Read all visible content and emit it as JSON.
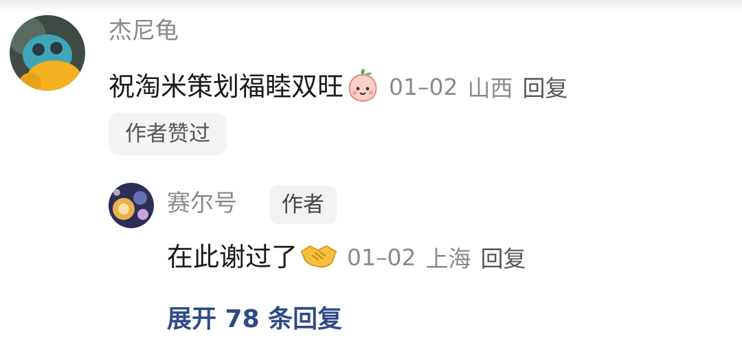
{
  "comment": {
    "username": "杰尼龟",
    "text": "祝淘米策划福睦双旺",
    "emoji": "peach-face-emoji",
    "date": "01–02",
    "location": "山西",
    "reply_label": "回复",
    "liked_badge": "作者赞过"
  },
  "reply": {
    "username": "赛尔号",
    "author_tag": "作者",
    "text": "在此谢过了",
    "emoji": "handshake-emoji",
    "date": "01–02",
    "location": "上海",
    "reply_label": "回复"
  },
  "expand_label": "展开 78 条回复",
  "colors": {
    "link_blue": "#2f4b86",
    "meta_gray": "#8a8a8a",
    "text": "#1a1a1a",
    "badge_bg": "#f4f4f4"
  }
}
